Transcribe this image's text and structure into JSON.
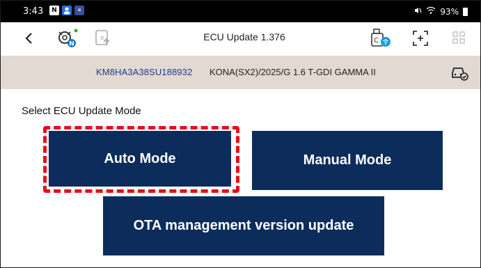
{
  "status_bar": {
    "time": "3:43",
    "notif_icons": [
      "N",
      "user",
      "app"
    ],
    "battery": "93%"
  },
  "app_bar": {
    "title": "ECU Update 1.376"
  },
  "vehicle": {
    "vin": "KM8HA3A38SU188932",
    "description": "KONA(SX2)/2025/G 1.6 T-GDI GAMMA II"
  },
  "main": {
    "section_title": "Select ECU Update Mode",
    "auto_mode_label": "Auto Mode",
    "manual_mode_label": "Manual Mode",
    "ota_label": "OTA management version update"
  },
  "colors": {
    "button_bg": "#0c2c5b",
    "vehicle_bar_bg": "#e2d9d3",
    "highlight": "#e3101c",
    "vin_text": "#1e3a8a"
  }
}
